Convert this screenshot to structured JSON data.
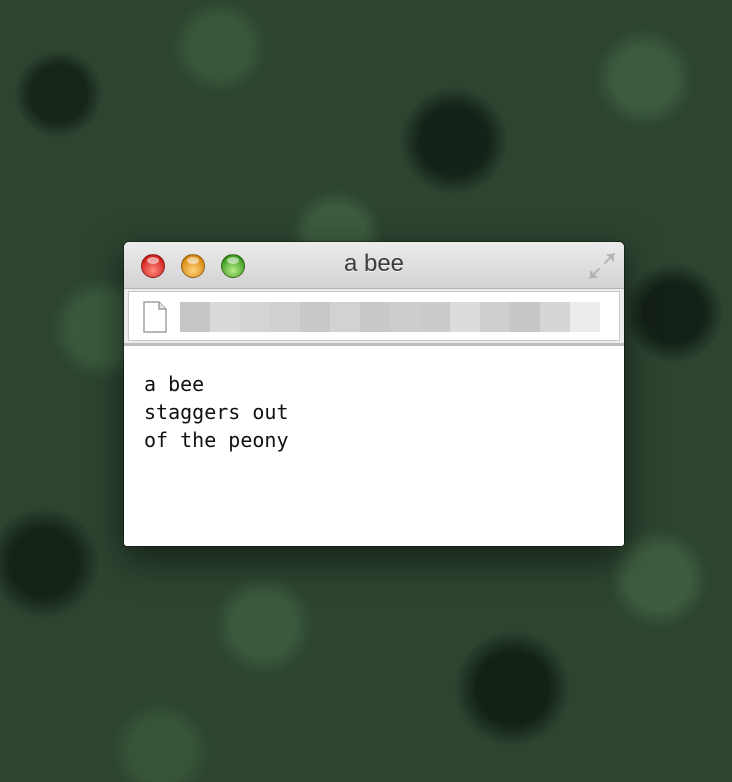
{
  "window": {
    "title": "a bee",
    "controls": {
      "close_color": "#ee3b34",
      "minimize_color": "#f5a623",
      "zoom_color": "#6cc644"
    },
    "icons": {
      "file": "document-icon",
      "fullscreen": "fullscreen-arrows-icon"
    }
  },
  "content": {
    "lines": [
      "a bee",
      "staggers out",
      "of the peony"
    ]
  }
}
